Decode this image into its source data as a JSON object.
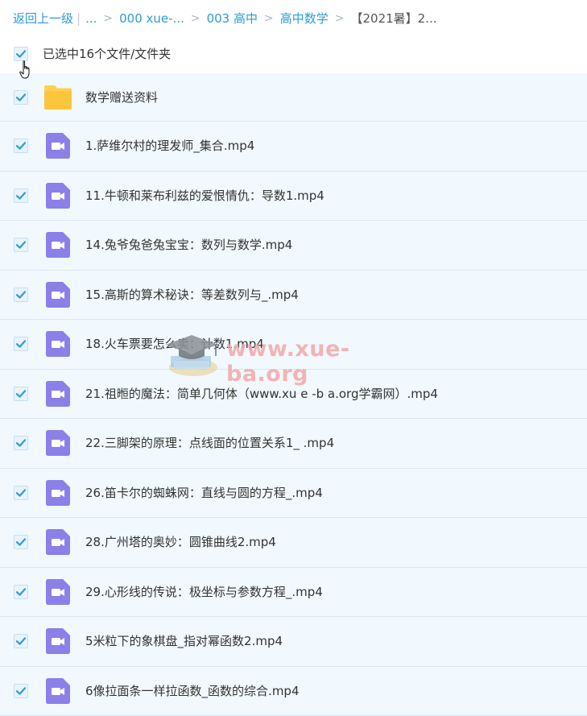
{
  "breadcrumb": {
    "back": "返回上一级",
    "pipe": "|",
    "ellipsis": "...",
    "sep": ">",
    "items": [
      "000 xue-...",
      "003 高中",
      "高中数学"
    ],
    "current": "【2021暑】2..."
  },
  "selection": {
    "label": "已选中16个文件/文件夹",
    "checked": true
  },
  "files": [
    {
      "name": "数学赠送资料",
      "type": "folder",
      "checked": true
    },
    {
      "name": "1.萨维尔村的理发师_集合.mp4",
      "type": "video",
      "checked": true
    },
    {
      "name": "11.牛顿和莱布利兹的爱恨情仇：导数1.mp4",
      "type": "video",
      "checked": true
    },
    {
      "name": "14.兔爷兔爸兔宝宝：数列与数学.mp4",
      "type": "video",
      "checked": true
    },
    {
      "name": "15.高斯的算术秘诀：等差数列与_.mp4",
      "type": "video",
      "checked": true
    },
    {
      "name": "18.火车票要怎么卖：计数1.mp4",
      "type": "video",
      "checked": true
    },
    {
      "name": "21.祖暅的魔法：简单几何体（www.xu e -b a.org学霸网）.mp4",
      "type": "video",
      "checked": true
    },
    {
      "name": "22.三脚架的原理：点线面的位置关系1_ .mp4",
      "type": "video",
      "checked": true
    },
    {
      "name": "26.笛卡尔的蜘蛛网：直线与圆的方程_.mp4",
      "type": "video",
      "checked": true
    },
    {
      "name": "28.广州塔的奥妙：圆锥曲线2.mp4",
      "type": "video",
      "checked": true
    },
    {
      "name": "29.心形线的传说：极坐标与参数方程_.mp4",
      "type": "video",
      "checked": true
    },
    {
      "name": "5米粒下的象棋盘_指对幂函数2.mp4",
      "type": "video",
      "checked": true
    },
    {
      "name": "6像拉面条一样拉函数_函数的综合.mp4",
      "type": "video",
      "checked": true
    }
  ],
  "watermark": {
    "text": "www.xue-ba.org"
  },
  "colors": {
    "link": "#2f9bd6",
    "row_bg": "#f1f8fe",
    "checkbox_tick": "#2f9bd6",
    "video_icon": "#8b7fe8",
    "folder_icon": "#fdd04f"
  }
}
